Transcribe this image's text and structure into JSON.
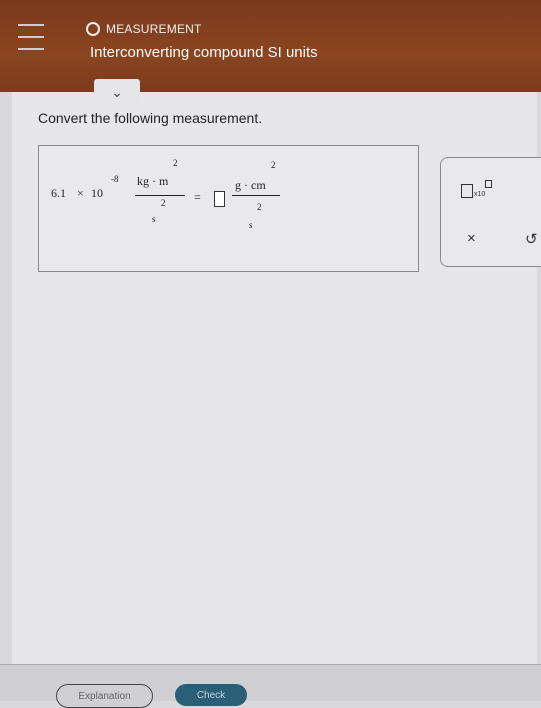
{
  "header": {
    "topic": "MEASUREMENT",
    "title": "Interconverting compound SI units"
  },
  "collapse_icon": "chevron-down",
  "prompt": "Convert the following measurement.",
  "expression": {
    "coefficient": "6.1",
    "times": "×",
    "base": "10",
    "exponent": "-8",
    "left_numerator_units": "kg · m",
    "left_numerator_power": "2",
    "left_denominator_unit": "s",
    "left_denominator_power": "2",
    "equals": "=",
    "right_numerator_units": "g · cm",
    "right_numerator_power": "2",
    "right_denominator_unit": "s",
    "right_denominator_power": "2"
  },
  "tools": {
    "x10_label": "x10",
    "clear_symbol": "×",
    "undo_symbol": "↺"
  },
  "footer": {
    "explanation_label": "Explanation",
    "check_label": "Check"
  }
}
